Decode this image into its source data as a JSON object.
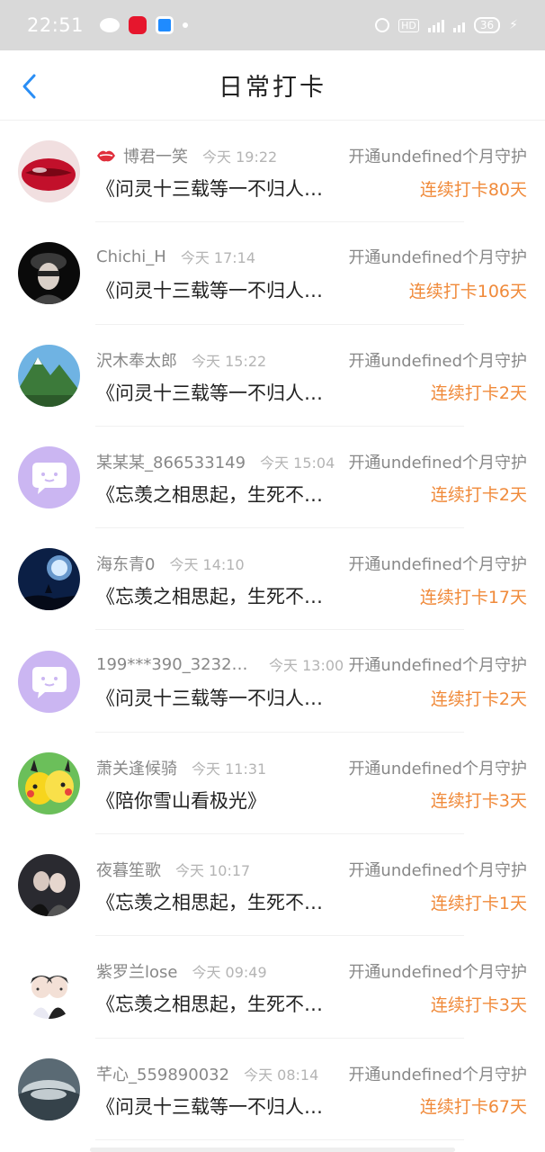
{
  "status_bar": {
    "time": "22:51",
    "hd": "HD",
    "battery": "36",
    "icons": [
      "wechat-icon",
      "weibo-icon",
      "app-icon",
      "alarm-icon",
      "signal-icon",
      "battery-icon"
    ]
  },
  "header": {
    "title": "日常打卡",
    "back_icon": "chevron-left-icon",
    "accent": "#2a8ef5"
  },
  "list": {
    "guard_label": "开通undefined个月守护",
    "items": [
      {
        "name": "博君一笑",
        "time": "今天 19:22",
        "content": "《问灵十三载等一不归人…",
        "streak": "连续打卡80天",
        "vip": true
      },
      {
        "name": "Chichi_H",
        "time": "今天 17:14",
        "content": "《问灵十三载等一不归人…",
        "streak": "连续打卡106天",
        "vip": false
      },
      {
        "name": "沢木奉太郎",
        "time": "今天 15:22",
        "content": "《问灵十三载等一不归人…",
        "streak": "连续打卡2天",
        "vip": false
      },
      {
        "name": "某某某_866533149",
        "time": "今天 15:04",
        "content": "《忘羡之相思起，生死不…",
        "streak": "连续打卡2天",
        "vip": false
      },
      {
        "name": "海东青0",
        "time": "今天 14:10",
        "content": "《忘羡之相思起，生死不…",
        "streak": "连续打卡17天",
        "vip": false
      },
      {
        "name": "199***390_32329…",
        "time": "今天 13:00",
        "content": "《问灵十三载等一不归人…",
        "streak": "连续打卡2天",
        "vip": false
      },
      {
        "name": "萧关逢候骑",
        "time": "今天 11:31",
        "content": "《陪你雪山看极光》",
        "streak": "连续打卡3天",
        "vip": false
      },
      {
        "name": "夜暮笙歌",
        "time": "今天 10:17",
        "content": "《忘羡之相思起，生死不…",
        "streak": "连续打卡1天",
        "vip": false
      },
      {
        "name": "紫罗兰lose",
        "time": "今天 09:49",
        "content": "《忘羡之相思起，生死不…",
        "streak": "连续打卡3天",
        "vip": false
      },
      {
        "name": "芊心_559890032",
        "time": "今天 08:14",
        "content": "《问灵十三载等一不归人…",
        "streak": "连续打卡67天",
        "vip": false
      }
    ]
  },
  "colors": {
    "streak": "#f08a3a",
    "muted": "#888888",
    "default_avatar": "#cbb6f2"
  }
}
